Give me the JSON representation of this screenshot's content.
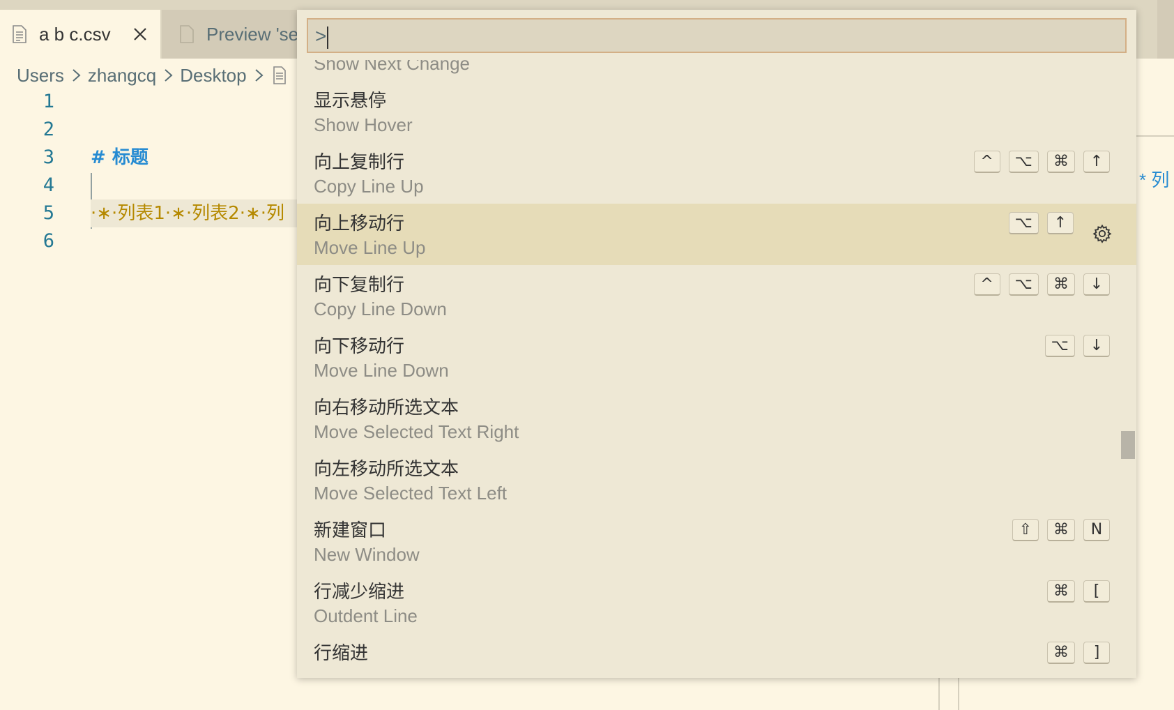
{
  "tabs": [
    {
      "label": "a b c.csv",
      "active": true
    },
    {
      "label": "Preview 'se",
      "active": false
    }
  ],
  "breadcrumb": [
    "Users",
    "zhangcq",
    "Desktop"
  ],
  "editor": {
    "line_numbers": [
      "1",
      "2",
      "3",
      "4",
      "5",
      "6"
    ],
    "heading_line": "#  标题",
    "list_line": "·∗·列表1·∗·列表2·∗·列"
  },
  "preview_fragment": "* 列",
  "command_palette": {
    "input_value": ">",
    "items": [
      {
        "label": "",
        "detail": "Show Next Change",
        "keys": []
      },
      {
        "label": "显示悬停",
        "detail": "Show Hover",
        "keys": []
      },
      {
        "label": "向上复制行",
        "detail": "Copy Line Up",
        "keys": [
          "^",
          "⌥",
          "⌘",
          "↑"
        ]
      },
      {
        "label": "向上移动行",
        "detail": "Move Line Up",
        "keys": [
          "⌥",
          "↑"
        ],
        "selected": true
      },
      {
        "label": "向下复制行",
        "detail": "Copy Line Down",
        "keys": [
          "^",
          "⌥",
          "⌘",
          "↓"
        ]
      },
      {
        "label": "向下移动行",
        "detail": "Move Line Down",
        "keys": [
          "⌥",
          "↓"
        ]
      },
      {
        "label": "向右移动所选文本",
        "detail": "Move Selected Text Right",
        "keys": []
      },
      {
        "label": "向左移动所选文本",
        "detail": "Move Selected Text Left",
        "keys": []
      },
      {
        "label": "新建窗口",
        "detail": "New Window",
        "keys": [
          "⇧",
          "⌘",
          "N"
        ]
      },
      {
        "label": "行减少缩进",
        "detail": "Outdent Line",
        "keys": [
          "⌘",
          "["
        ]
      },
      {
        "label": "行缩进",
        "detail": "",
        "keys": [
          "⌘",
          "]"
        ]
      }
    ]
  },
  "icons": {
    "tab_file": "file-icon",
    "tab_close": "close-icon",
    "breadcrumb_sep": "chevron-right-icon",
    "settings": "gear-icon"
  },
  "colors": {
    "background": "#FDF6E3",
    "palette_bg": "#EEE8D5",
    "selected_row": "#E6DCB8",
    "heading": "#268BD2",
    "list_text": "#B58900",
    "line_number": "#237893",
    "input_border": "#D3AF86"
  }
}
